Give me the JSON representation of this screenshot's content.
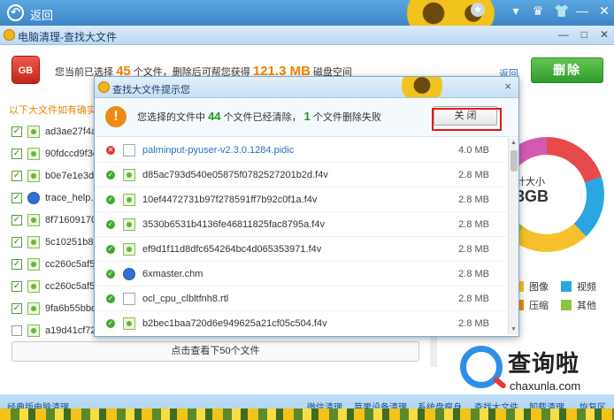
{
  "topbar": {
    "back_label": "返回",
    "star_icon": "★",
    "icons": [
      "▾",
      "♛",
      "👕",
      "—",
      "✕"
    ]
  },
  "window": {
    "title": "电脑清理-查找大文件",
    "controls": [
      "—",
      "□",
      "✕"
    ]
  },
  "summary": {
    "prefix": "您当前已选择",
    "count": "45",
    "mid": "个文件，删除后可帮您获得",
    "size": "121.3 MB",
    "suffix": "磁盘空间"
  },
  "return_label": "返回",
  "delete_label": "删除",
  "hint": "以下大文件如有确实不需",
  "rows": [
    {
      "name": "ad3ae27f4a25",
      "checked": true,
      "icon": "file"
    },
    {
      "name": "90fdccd9f3cc5",
      "checked": true,
      "icon": "file"
    },
    {
      "name": "b0e7e1e3da1",
      "checked": true,
      "icon": "file"
    },
    {
      "name": "trace_help.hlp",
      "checked": true,
      "icon": "help"
    },
    {
      "name": "8f716091700f",
      "checked": true,
      "icon": "file"
    },
    {
      "name": "5c10251b88f8",
      "checked": true,
      "icon": "file"
    },
    {
      "name": "cc260c5af598",
      "checked": true,
      "icon": "file"
    },
    {
      "name": "cc260c5af598",
      "checked": true,
      "icon": "file"
    },
    {
      "name": "9fa6b55bbdd",
      "checked": true,
      "icon": "file"
    },
    {
      "name": "a19d41cf72b1",
      "checked": false,
      "icon": "file"
    }
  ],
  "more_button": "点击查看下50个文件",
  "donut": {
    "line1": "计大小",
    "line2": "3GB"
  },
  "legend": [
    {
      "label": "图像",
      "color": "#f5c02b"
    },
    {
      "label": "视频",
      "color": "#2aa7e0"
    },
    {
      "label": "压缩",
      "color": "#f08a12"
    },
    {
      "label": "其他",
      "color": "#8bc53f"
    }
  ],
  "bottom_links": [
    "经典版电脑清理",
    "微信清理",
    "苹果设备清理",
    "系统盘瘦身",
    "查找大文件",
    "卸载清理",
    "恢复区"
  ],
  "dialog": {
    "title": "查找大文件提示您",
    "close_x": "×",
    "message_prefix": "您选择的文件中",
    "cleared": "44",
    "message_mid": "个文件已经清除，",
    "failed": "1",
    "message_suffix": "个文件删除失败",
    "close_button": "关 闭",
    "files": [
      {
        "name": "palminput-pyuser-v2.3.0.1284.pidic",
        "size": "4.0 MB",
        "status": "fail",
        "icon": "doc"
      },
      {
        "name": "d85ac793d540e05875f0782527201b2d.f4v",
        "size": "2.8 MB",
        "status": "ok",
        "icon": "file"
      },
      {
        "name": "10ef4472731b97f278591ff7b92c0f1a.f4v",
        "size": "2.8 MB",
        "status": "ok",
        "icon": "file"
      },
      {
        "name": "3530b6531b4136fe46811825fac8795a.f4v",
        "size": "2.8 MB",
        "status": "ok",
        "icon": "file"
      },
      {
        "name": "ef9d1f11d8dfc654264bc4d065353971.f4v",
        "size": "2.8 MB",
        "status": "ok",
        "icon": "file"
      },
      {
        "name": "6xmaster.chm",
        "size": "2.8 MB",
        "status": "ok",
        "icon": "help"
      },
      {
        "name": "ocl_cpu_clbltfnh8.rtl",
        "size": "2.8 MB",
        "status": "ok",
        "icon": "doc"
      },
      {
        "name": "b2bec1baa720d6e949625a21cf05c504.f4v",
        "size": "2.8 MB",
        "status": "ok",
        "icon": "file"
      }
    ]
  },
  "watermark": {
    "title": "查询啦",
    "url": "chaxunla.com"
  }
}
